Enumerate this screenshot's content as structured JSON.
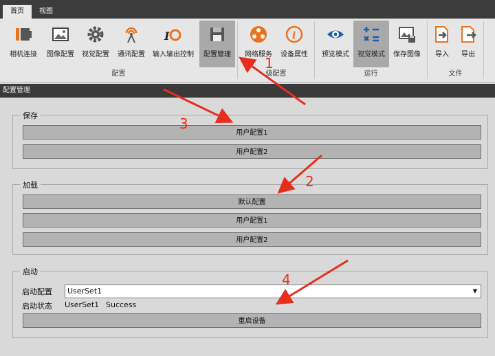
{
  "tabs": [
    {
      "label": "首页",
      "active": true
    },
    {
      "label": "视图",
      "active": false
    }
  ],
  "ribbon": {
    "buttons": [
      {
        "id": "camera",
        "label": "相机连接",
        "icon": "camera-connect-icon"
      },
      {
        "id": "image",
        "label": "图像配置",
        "icon": "image-config-icon"
      },
      {
        "id": "vision",
        "label": "视觉配置",
        "icon": "gear-icon"
      },
      {
        "id": "comm",
        "label": "通讯配置",
        "icon": "antenna-icon"
      },
      {
        "id": "io",
        "label": "输入输出控制",
        "icon": "io-icon"
      },
      {
        "id": "cfg",
        "label": "配置管理",
        "icon": "save-disk-icon",
        "selected": true
      },
      {
        "id": "net",
        "label": "网络服务",
        "icon": "network-icon"
      },
      {
        "id": "devprop",
        "label": "设备属性",
        "icon": "info-icon"
      },
      {
        "id": "preview",
        "label": "预览模式",
        "icon": "eye-icon"
      },
      {
        "id": "visionmode",
        "label": "视觉模式",
        "icon": "calc-icon",
        "selected": true
      },
      {
        "id": "saveimg",
        "label": "保存图像",
        "icon": "save-image-icon"
      },
      {
        "id": "import",
        "label": "导入",
        "icon": "import-icon"
      },
      {
        "id": "export",
        "label": "导出",
        "icon": "export-icon"
      }
    ],
    "groups": [
      "配置",
      "级配置",
      "运行",
      "文件"
    ]
  },
  "panel": {
    "title": "配置管理"
  },
  "save": {
    "legend": "保存",
    "buttons": [
      "用户配置1",
      "用户配置2"
    ]
  },
  "load": {
    "legend": "加载",
    "buttons": [
      "默认配置",
      "用户配置1",
      "用户配置2"
    ]
  },
  "startup": {
    "legend": "启动",
    "config_label": "启动配置",
    "config_value": "UserSet1",
    "status_label": "启动状态",
    "status_set": "UserSet1",
    "status_result": "Success",
    "restart_label": "重启设备"
  },
  "annotations": [
    "1",
    "2",
    "3",
    "4"
  ],
  "colors": {
    "accent": "#e62e1f",
    "orange": "#e8731e",
    "blue": "#1a5fa8",
    "ribbon_bg": "#e6e6e6"
  }
}
